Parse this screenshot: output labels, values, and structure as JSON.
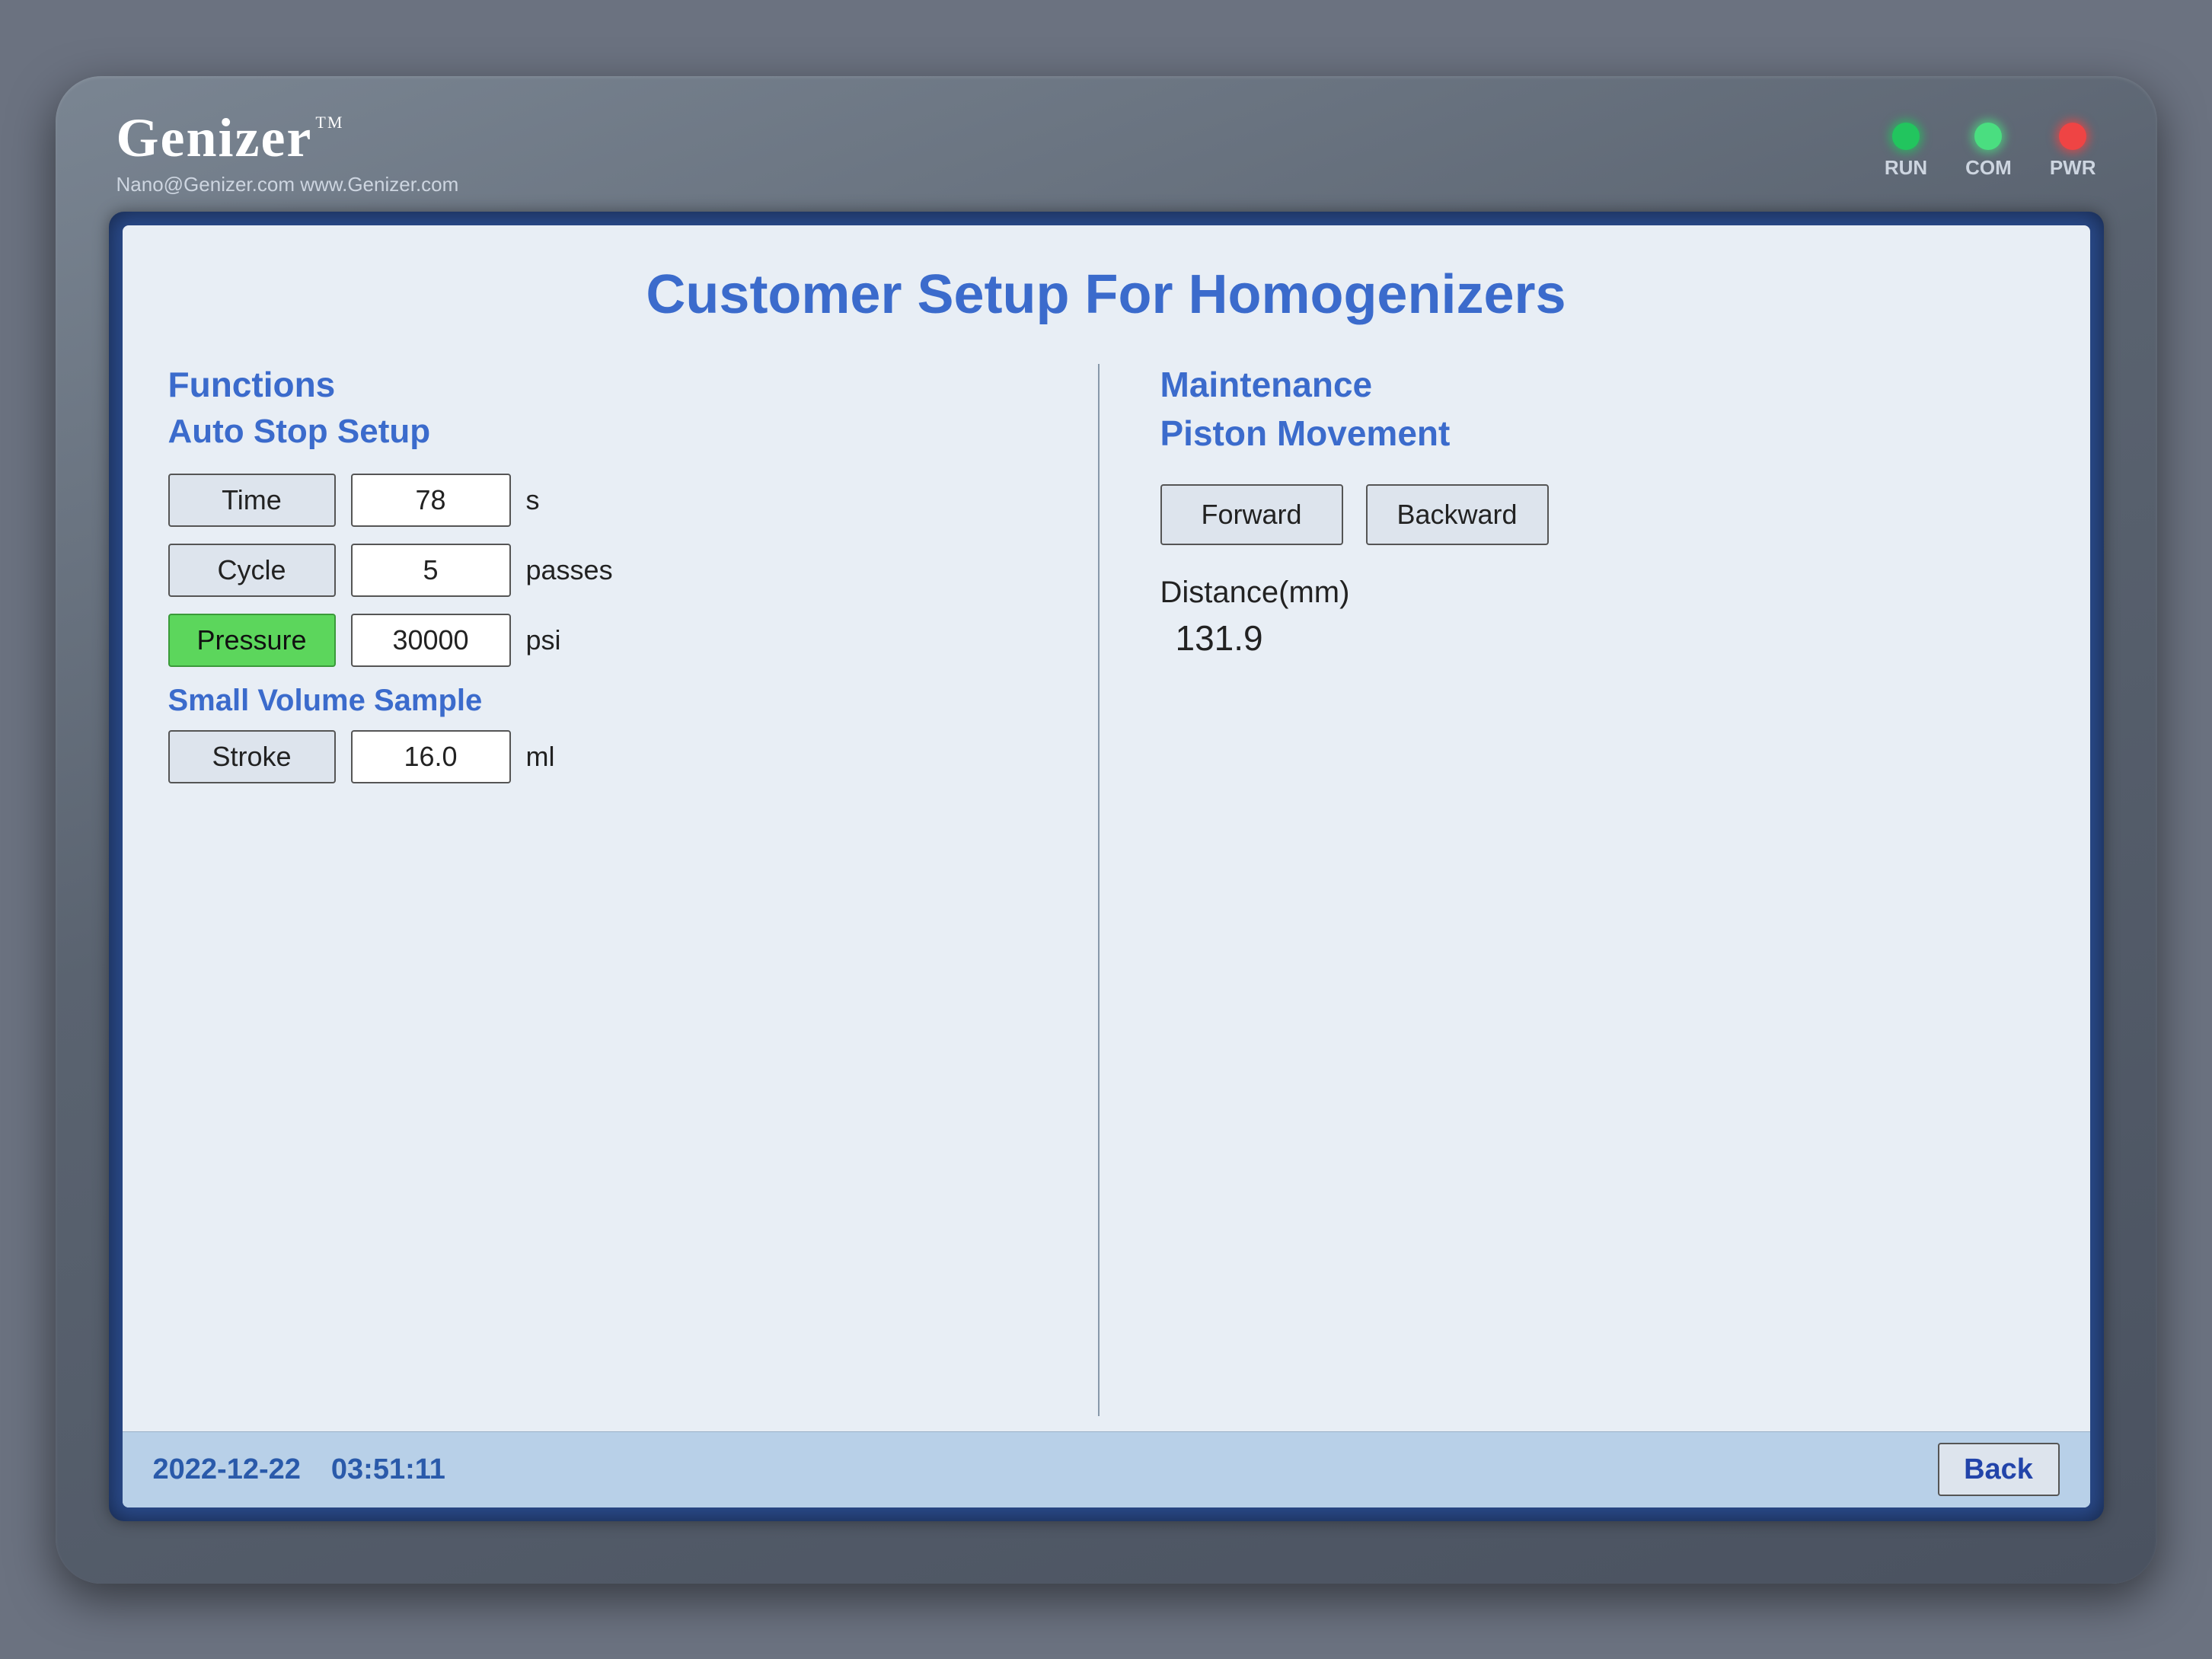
{
  "device": {
    "brand": "Genizer",
    "tm": "TM",
    "contact": "Nano@Genizer.com  www.Genizer.com"
  },
  "status_lights": [
    {
      "id": "run",
      "label": "RUN",
      "color": "green"
    },
    {
      "id": "com",
      "label": "COM",
      "color": "green2"
    },
    {
      "id": "pwr",
      "label": "PWR",
      "color": "red"
    }
  ],
  "screen": {
    "title": "Customer Setup For Homogenizers",
    "left": {
      "functions_label": "Functions",
      "auto_stop_label": "Auto Stop Setup",
      "fields": [
        {
          "label": "Time",
          "value": "78",
          "unit": "s",
          "active": false
        },
        {
          "label": "Cycle",
          "value": "5",
          "unit": "passes",
          "active": false
        },
        {
          "label": "Pressure",
          "value": "30000",
          "unit": "psi",
          "active": true
        }
      ],
      "small_volume_label": "Small Volume Sample",
      "stroke_label": "Stroke",
      "stroke_value": "16.0",
      "stroke_unit": "ml"
    },
    "right": {
      "maintenance_label": "Maintenance",
      "piston_movement_label": "Piston Movement",
      "forward_btn": "Forward",
      "backward_btn": "Backward",
      "distance_label": "Distance(mm)",
      "distance_value": "131.9"
    },
    "footer": {
      "date": "2022-12-22",
      "time": "03:51:11",
      "back_btn": "Back"
    }
  }
}
